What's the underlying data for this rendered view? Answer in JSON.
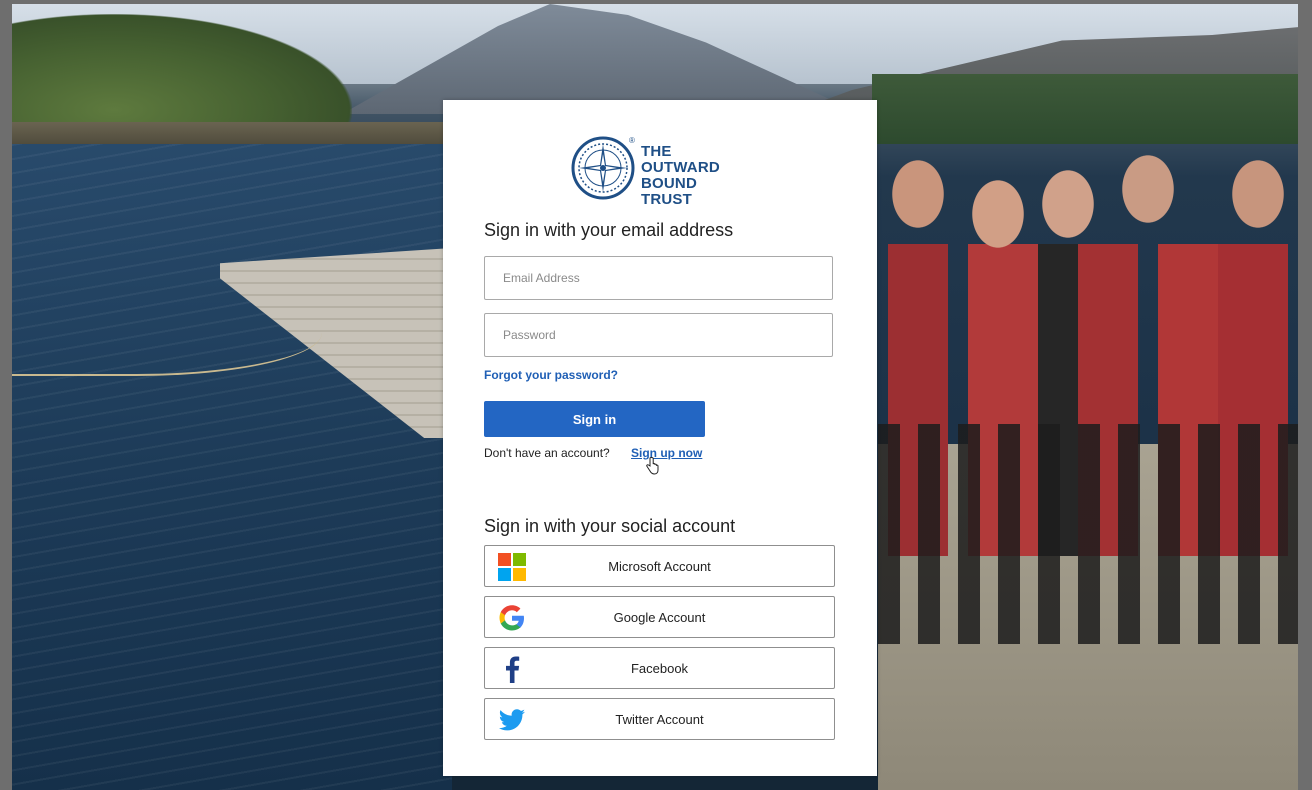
{
  "brand": {
    "name_line1": "THE",
    "name_line2": "OUTWARD",
    "name_line3": "BOUND TRUST",
    "registered": "®",
    "color": "#1f4f86"
  },
  "email_section": {
    "heading": "Sign in with your email address",
    "email_placeholder": "Email Address",
    "email_value": "",
    "password_placeholder": "Password",
    "password_value": "",
    "forgot_link": "Forgot your password?",
    "signin_label": "Sign in",
    "no_account_text": "Don't have an account?",
    "signup_link": "Sign up now",
    "button_color": "#2366c3",
    "link_color": "#1f5fb5"
  },
  "social_section": {
    "heading": "Sign in with your social account",
    "providers": [
      {
        "label": "Microsoft Account",
        "icon": "microsoft-icon"
      },
      {
        "label": "Google Account",
        "icon": "google-icon"
      },
      {
        "label": "Facebook",
        "icon": "facebook-icon"
      },
      {
        "label": "Twitter Account",
        "icon": "twitter-icon"
      }
    ]
  }
}
